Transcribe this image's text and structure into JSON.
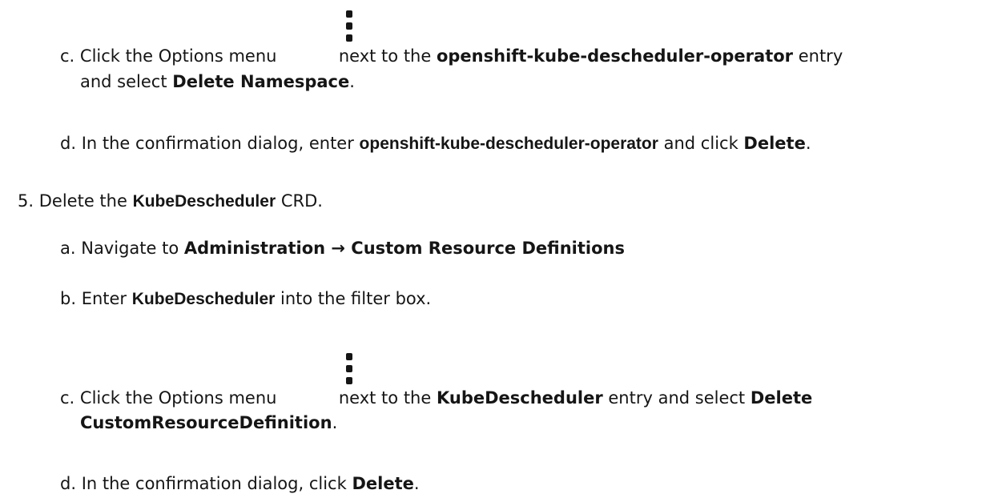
{
  "step4c": {
    "marker": "c.",
    "text_before": "Click the Options menu",
    "text_middle": "next to the",
    "entry": "openshift-kube-descheduler-operator",
    "text_after": "entry",
    "line2_before": "and select",
    "action": "Delete Namespace",
    "line2_after": "."
  },
  "step4d": {
    "marker": "d.",
    "text_before": "In the confirmation dialog, enter",
    "entry": "openshift-kube-descheduler-operator",
    "text_middle": "and click",
    "action": "Delete",
    "text_after": "."
  },
  "step5": {
    "marker": "5.",
    "text_before": "Delete the",
    "entry": "KubeDescheduler",
    "text_after": "CRD."
  },
  "step5a": {
    "marker": "a.",
    "text_before": "Navigate to",
    "nav_path": "Administration → Custom Resource Definitions"
  },
  "step5b": {
    "marker": "b.",
    "text_before": "Enter",
    "entry": "KubeDescheduler",
    "text_after": "into the filter box."
  },
  "step5c": {
    "marker": "c.",
    "text_before": "Click the Options menu",
    "text_middle": "next to the",
    "entry": "KubeDescheduler",
    "text_after": "entry and select",
    "action_line1": "Delete",
    "action_line2": "CustomResourceDefinition",
    "line2_after": "."
  },
  "step5d": {
    "marker": "d.",
    "text_before": "In the confirmation dialog, click",
    "action": "Delete",
    "text_after": "."
  }
}
